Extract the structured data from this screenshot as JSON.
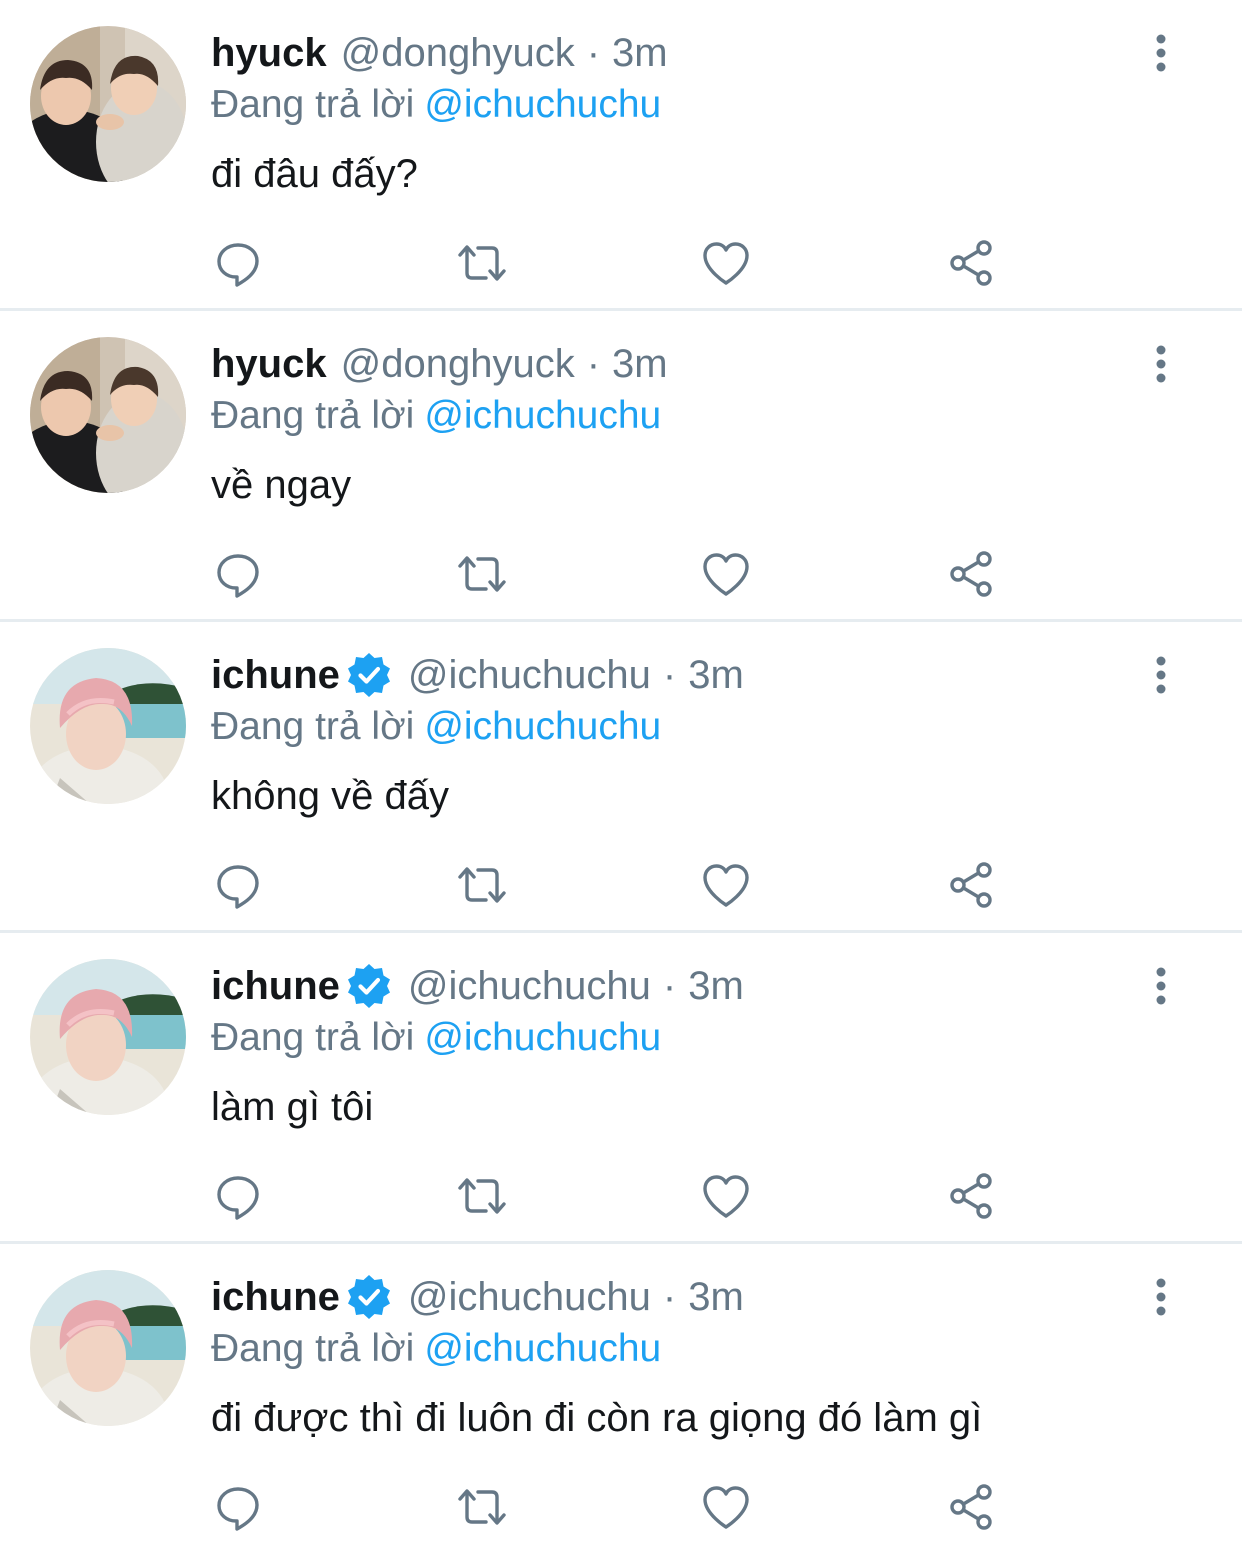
{
  "colors": {
    "text": "#14171a",
    "secondary": "#657786",
    "link": "#1da1f2",
    "divider": "#e6ecf0",
    "verified": "#1da1f2"
  },
  "icons": {
    "reply": "reply-icon",
    "retweet": "retweet-icon",
    "like": "heart-icon",
    "share": "share-icon",
    "more": "more-vertical-icon",
    "verified": "verified-badge-icon"
  },
  "tweets": [
    {
      "name": "hyuck",
      "verified": false,
      "handle": "@donghyuck",
      "dot": "·",
      "time": "3m",
      "reply_prefix": "Đang trả lời",
      "reply_to": "@ichuchuchu",
      "text": "đi đâu đấy?"
    },
    {
      "name": "hyuck",
      "verified": false,
      "handle": "@donghyuck",
      "dot": "·",
      "time": "3m",
      "reply_prefix": "Đang trả lời",
      "reply_to": "@ichuchuchu",
      "text": "về ngay"
    },
    {
      "name": "ichune",
      "verified": true,
      "handle": "@ichuchuchu",
      "dot": "·",
      "time": "3m",
      "reply_prefix": "Đang trả lời",
      "reply_to": "@ichuchuchu",
      "text": "không về đấy"
    },
    {
      "name": "ichune",
      "verified": true,
      "handle": "@ichuchuchu",
      "dot": "·",
      "time": "3m",
      "reply_prefix": "Đang trả lời",
      "reply_to": "@ichuchuchu",
      "text": "làm gì tôi"
    },
    {
      "name": "ichune",
      "verified": true,
      "handle": "@ichuchuchu",
      "dot": "·",
      "time": "3m",
      "reply_prefix": "Đang trả lời",
      "reply_to": "@ichuchuchu",
      "text": "đi được thì đi luôn đi còn ra giọng đó làm gì"
    }
  ]
}
